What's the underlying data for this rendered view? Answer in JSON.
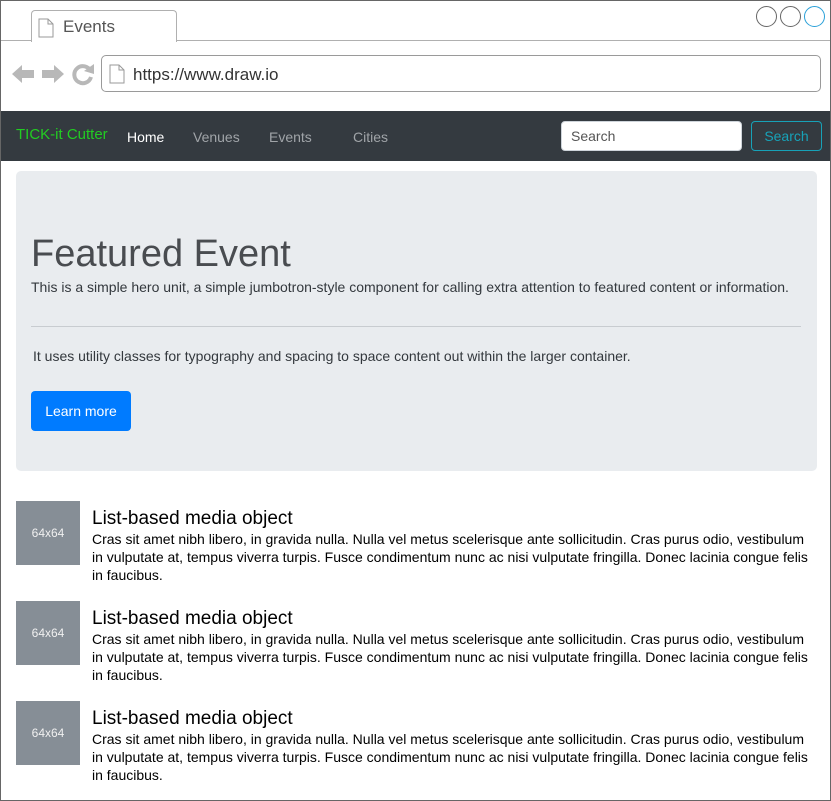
{
  "browser": {
    "tab_title": "Events",
    "url": "https://www.draw.io"
  },
  "navbar": {
    "brand": "TICK-it Cutter",
    "links": [
      "Home",
      "Venues",
      "Events",
      "Cities"
    ],
    "active_link": "Home",
    "search_placeholder": "Search",
    "search_button": "Search"
  },
  "jumbotron": {
    "title": "Featured Event",
    "lead": "This is a simple hero unit, a simple jumbotron-style component for calling extra attention to featured content or information.",
    "text": "It uses utility classes for typography and spacing to space content out within the larger container.",
    "button": "Learn more"
  },
  "media_list": [
    {
      "image_label": "64x64",
      "heading": "List-based media object",
      "text": "Cras sit amet nibh libero, in gravida nulla. Nulla vel metus scelerisque ante sollicitudin. Cras purus odio, vestibulum in vulputate at, tempus viverra turpis. Fusce condimentum nunc ac nisi vulputate fringilla. Donec lacinia congue felis in faucibus."
    },
    {
      "image_label": "64x64",
      "heading": "List-based media object",
      "text": "Cras sit amet nibh libero, in gravida nulla. Nulla vel metus scelerisque ante sollicitudin. Cras purus odio, vestibulum in vulputate at, tempus viverra turpis. Fusce condimentum nunc ac nisi vulputate fringilla. Donec lacinia congue felis in faucibus."
    },
    {
      "image_label": "64x64",
      "heading": "List-based media object",
      "text": "Cras sit amet nibh libero, in gravida nulla. Nulla vel metus scelerisque ante sollicitudin. Cras purus odio, vestibulum in vulputate at, tempus viverra turpis. Fusce condimentum nunc ac nisi vulputate fringilla. Donec lacinia congue felis in faucibus."
    }
  ],
  "colors": {
    "navbar_bg": "#343a40",
    "brand": "#22cc22",
    "jumbotron_bg": "#e9ecef",
    "primary": "#007bff",
    "outline_info": "#17a2b8",
    "media_placeholder": "#868e96"
  },
  "icons": [
    "document-icon",
    "back-arrow-icon",
    "forward-arrow-icon",
    "reload-icon",
    "window-control-icon"
  ]
}
